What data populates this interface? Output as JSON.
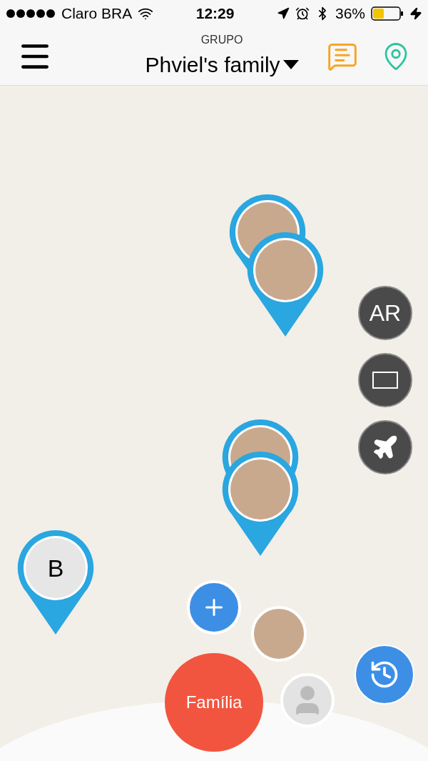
{
  "status_bar": {
    "carrier": "Claro BRA",
    "time": "12:29",
    "battery_text": "36%"
  },
  "header": {
    "group_label": "GRUPO",
    "group_name": "Phviel's family"
  },
  "pins": [
    {
      "kind": "photo"
    },
    {
      "kind": "photo"
    },
    {
      "kind": "photo"
    },
    {
      "kind": "photo"
    },
    {
      "kind": "initial",
      "initial": "B"
    }
  ],
  "side_buttons": [
    {
      "kind": "text",
      "label": "AR"
    },
    {
      "kind": "screen"
    },
    {
      "kind": "plane"
    }
  ],
  "main_button": "Família"
}
